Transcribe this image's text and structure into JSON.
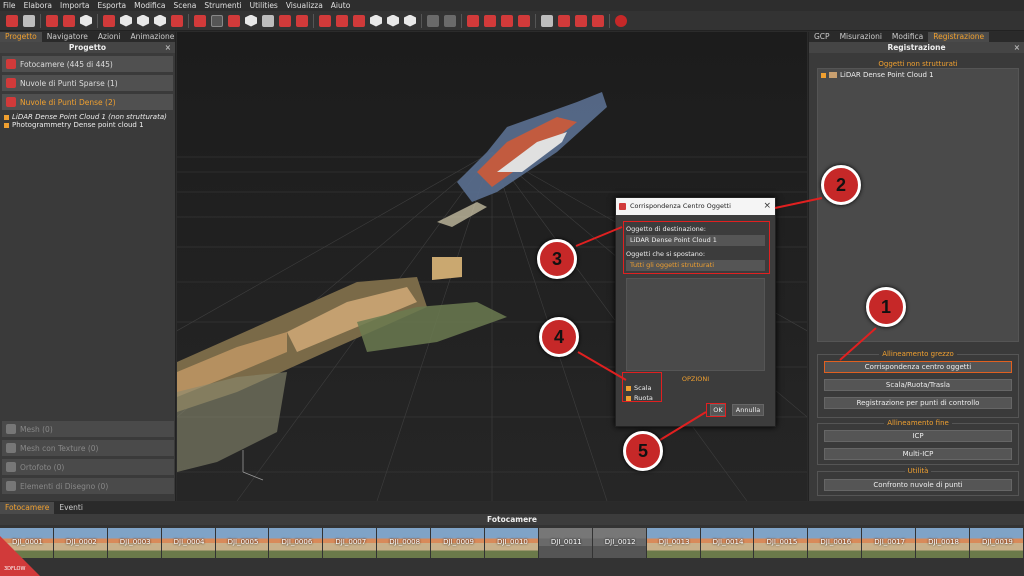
{
  "menu": [
    "File",
    "Elabora",
    "Importa",
    "Esporta",
    "Modifica",
    "Scena",
    "Strumenti",
    "Utilities",
    "Visualizza",
    "Aiuto"
  ],
  "left": {
    "tabs": [
      "Progetto",
      "Navigatore",
      "Azioni",
      "Animazione"
    ],
    "title": "Progetto",
    "close": "×",
    "cameras": "Fotocamere (445 di 445)",
    "sparse": "Nuvole di Punti Sparse (1)",
    "dense": "Nuvole di Punti Dense (2)",
    "tree": [
      "LiDAR Dense Point Cloud 1 (non strutturata)",
      "Photogrammetry Dense point cloud 1"
    ],
    "mesh": "Mesh (0)",
    "texture": "Mesh con Texture (0)",
    "ortho": "Ortofoto (0)",
    "drawing": "Elementi di Disegno (0)"
  },
  "right": {
    "tabs": [
      "GCP",
      "Misurazioni",
      "Modifica",
      "Registrazione"
    ],
    "title": "Registrazione",
    "close": "×",
    "unstructured_title": "Oggetti non strutturati",
    "unstructured_item": "LiDAR Dense Point Cloud 1",
    "coarse_title": "Allineamento grezzo",
    "btn_center": "Corrispondenza centro oggetti",
    "btn_srt": "Scala/Ruota/Trasla",
    "btn_cp": "Registrazione per punti di controllo",
    "fine_title": "Allineamento fine",
    "btn_icp": "ICP",
    "btn_multi": "Multi-ICP",
    "util_title": "Utilità",
    "btn_compare": "Confronto nuvole di punti"
  },
  "dialog": {
    "title": "Corrispondenza Centro Oggetti",
    "close": "×",
    "dest_label": "Oggetto di destinazione:",
    "dest_value": "LiDAR Dense Point Cloud 1",
    "move_label": "Oggetti che si spostano:",
    "move_value": "Tutti gli oggetti strutturati",
    "options": "OPZIONI",
    "scale": "Scala",
    "rotate": "Ruota",
    "ok": "OK",
    "cancel": "Annulla"
  },
  "markers": [
    "1",
    "2",
    "3",
    "4",
    "5"
  ],
  "bottom": {
    "tabs": [
      "Fotocamere",
      "Eventi"
    ],
    "title": "Fotocamere",
    "thumbs": [
      "DJI_0001",
      "DJI_0002",
      "DJI_0003",
      "DJI_0004",
      "DJI_0005",
      "DJI_0006",
      "DJI_0007",
      "DJI_0008",
      "DJI_0009",
      "DJI_0010",
      "DJI_0011",
      "DJI_0012",
      "DJI_0013",
      "DJI_0014",
      "DJI_0015",
      "DJI_0016",
      "DJI_0017",
      "DJI_0018",
      "DJI_0019"
    ],
    "logo": "3DFLOW"
  },
  "colors": {
    "accent": "#f0a030",
    "brand": "#d13a3a",
    "highlight": "#e02020"
  }
}
